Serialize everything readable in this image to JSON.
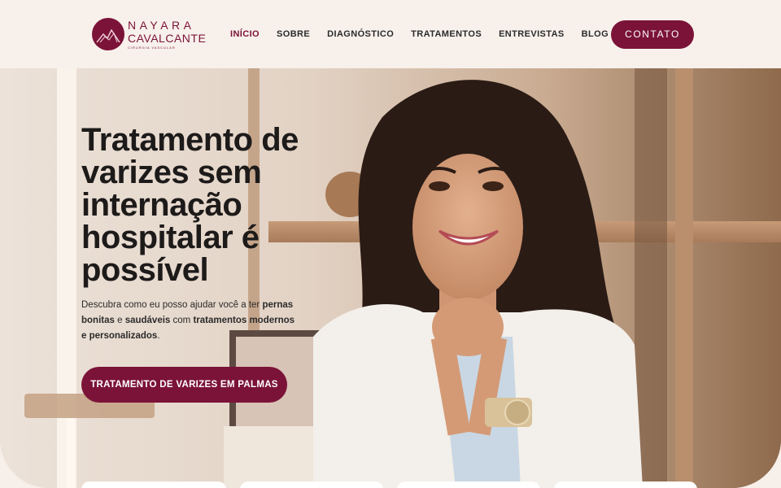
{
  "brand": {
    "name": "NAYARA",
    "surname": "CAVALCANTE",
    "tagline": "CIRURGIA VASCULAR",
    "logo_icon": "logo-mark",
    "color": "#7b1338"
  },
  "nav": {
    "items": [
      {
        "label": "INÍCIO",
        "active": true
      },
      {
        "label": "SOBRE",
        "active": false
      },
      {
        "label": "DIAGNÓSTICO",
        "active": false
      },
      {
        "label": "TRATAMENTOS",
        "active": false
      },
      {
        "label": "ENTREVISTAS",
        "active": false
      },
      {
        "label": "BLOG",
        "active": false
      }
    ],
    "contact_label": "CONTATO"
  },
  "hero": {
    "title": "Tratamento de varizes sem internação hospitalar é possível",
    "description": {
      "part1": "Descubra como eu posso ajudar você a ter ",
      "bold1": "pernas bonitas",
      "part2": " e ",
      "bold2": "saudáveis",
      "part3": " com ",
      "bold3": "tratamentos modernos e personalizados",
      "part4": "."
    },
    "cta_label": "TRATAMENTO DE VARIZES EM PALMAS"
  }
}
